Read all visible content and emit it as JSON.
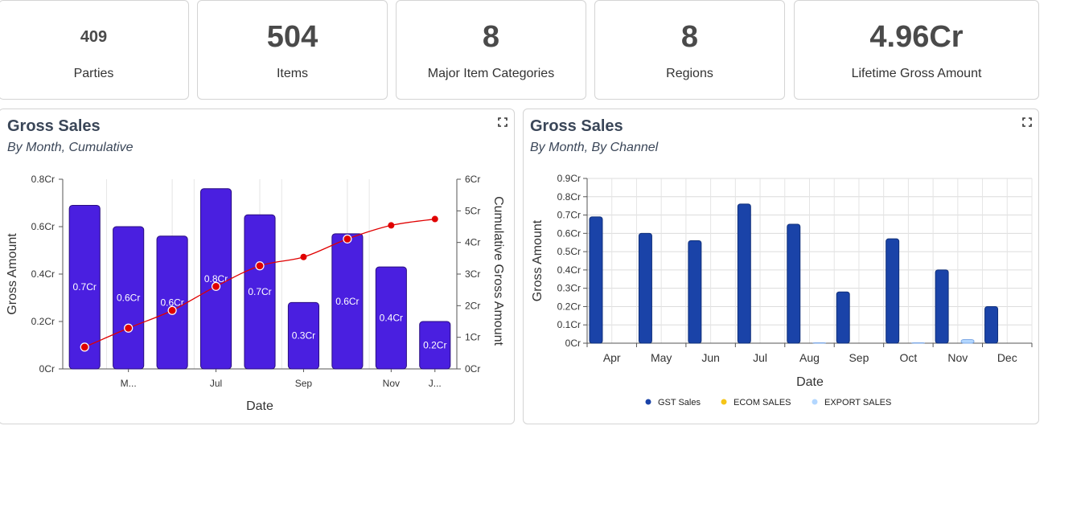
{
  "kpis": [
    {
      "value": "409",
      "label": "Parties"
    },
    {
      "value": "504",
      "label": "Items"
    },
    {
      "value": "8",
      "label": "Major Item Categories"
    },
    {
      "value": "8",
      "label": "Regions"
    },
    {
      "value": "4.96Cr",
      "label": "Lifetime Gross Amount"
    }
  ],
  "panel_left": {
    "title": "Gross Sales",
    "subtitle": "By Month, Cumulative"
  },
  "panel_right": {
    "title": "Gross Sales",
    "subtitle": "By Month, By Channel"
  },
  "colors": {
    "bar": "#4a1fe0",
    "line": "#e00000",
    "gst": "#1a43a8",
    "ecom": "#f5c518",
    "export": "#b3d7ff"
  },
  "chart_data": [
    {
      "type": "bar",
      "categories": [
        "Apr",
        "May",
        "Jun",
        "Jul",
        "Aug",
        "Sep",
        "Oct",
        "Nov",
        "Dec"
      ],
      "x_tick_labels": [
        "M...",
        "Jul",
        "Sep",
        "Nov",
        "J..."
      ],
      "values": [
        0.69,
        0.6,
        0.56,
        0.76,
        0.65,
        0.28,
        0.57,
        0.43,
        0.2
      ],
      "bar_labels": [
        "0.7Cr",
        "0.6Cr",
        "0.6Cr",
        "0.8Cr",
        "0.7Cr",
        "0.3Cr",
        "0.6Cr",
        "0.4Cr",
        "0.2Cr"
      ],
      "cumulative": [
        0.69,
        1.29,
        1.85,
        2.61,
        3.26,
        3.54,
        4.11,
        4.54,
        4.74
      ],
      "cumulative_markers": [
        true,
        true,
        true,
        true,
        true,
        false,
        true,
        false,
        false
      ],
      "xlabel": "Date",
      "ylabel": "Gross Amount",
      "y2label": "Cumulative Gross Amount",
      "ylim": [
        0,
        0.8
      ],
      "y2lim": [
        0,
        6
      ],
      "yticks": [
        "0Cr",
        "0.2Cr",
        "0.4Cr",
        "0.6Cr",
        "0.8Cr"
      ],
      "y2ticks": [
        "0Cr",
        "1Cr",
        "2Cr",
        "3Cr",
        "4Cr",
        "5Cr",
        "6Cr"
      ]
    },
    {
      "type": "bar",
      "categories": [
        "Apr",
        "May",
        "Jun",
        "Jul",
        "Aug",
        "Sep",
        "Oct",
        "Nov",
        "Dec"
      ],
      "series": [
        {
          "name": "GST Sales",
          "values": [
            0.69,
            0.6,
            0.56,
            0.76,
            0.65,
            0.28,
            0.57,
            0.4,
            0.2
          ]
        },
        {
          "name": "ECOM SALES",
          "values": [
            0,
            0,
            0,
            0,
            0,
            0,
            0,
            0,
            0
          ]
        },
        {
          "name": "EXPORT SALES",
          "values": [
            0,
            0,
            0,
            0,
            0.002,
            0,
            0.002,
            0.02,
            0
          ]
        }
      ],
      "xlabel": "Date",
      "ylabel": "Gross Amount",
      "ylim": [
        0,
        0.9
      ],
      "yticks": [
        "0Cr",
        "0.1Cr",
        "0.2Cr",
        "0.3Cr",
        "0.4Cr",
        "0.5Cr",
        "0.6Cr",
        "0.7Cr",
        "0.8Cr",
        "0.9Cr"
      ],
      "legend_position": "bottom"
    }
  ]
}
